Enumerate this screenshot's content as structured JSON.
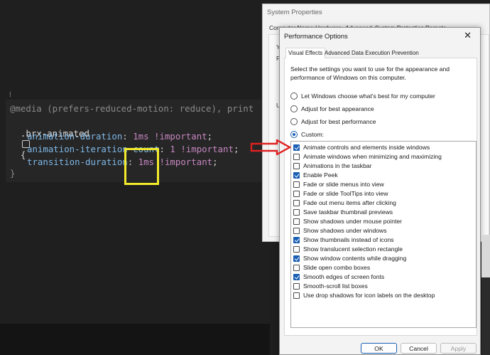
{
  "editor": {
    "gutter_mark": "⁞",
    "lines": {
      "media": "@media (prefers-reduced-motion: reduce), print",
      "selector": ".brx-animated",
      "brace_open": "{",
      "l1_prop": "animation-duration",
      "l1_val": "1ms !important",
      "l2_prop": "animation-iteration-count",
      "l2_val": "1 !important",
      "l3_prop": "transition-duration",
      "l3_val": "1ms !important",
      "brace_close": "}"
    },
    "highlight_color": "#f3ea2a"
  },
  "system_properties": {
    "title": "System Properties",
    "tabs": [
      "Computer Name",
      "Hardware",
      "Advanced",
      "System Protection",
      "Remote"
    ],
    "fragments": [
      "Y",
      "P",
      "U"
    ]
  },
  "performance_options": {
    "title": "Performance Options",
    "close_glyph": "✕",
    "tabs": [
      "Visual Effects",
      "Advanced",
      "Data Execution Prevention"
    ],
    "active_tab": "Visual Effects",
    "description": "Select the settings you want to use for the appearance and performance of Windows on this computer.",
    "radios": [
      {
        "label": "Let Windows choose what's best for my computer",
        "selected": false
      },
      {
        "label": "Adjust for best appearance",
        "selected": false
      },
      {
        "label": "Adjust for best performance",
        "selected": false
      },
      {
        "label": "Custom:",
        "selected": true
      }
    ],
    "options": [
      {
        "label": "Animate controls and elements inside windows",
        "checked": true
      },
      {
        "label": "Animate windows when minimizing and maximizing",
        "checked": false
      },
      {
        "label": "Animations in the taskbar",
        "checked": false
      },
      {
        "label": "Enable Peek",
        "checked": true
      },
      {
        "label": "Fade or slide menus into view",
        "checked": false
      },
      {
        "label": "Fade or slide ToolTips into view",
        "checked": false
      },
      {
        "label": "Fade out menu items after clicking",
        "checked": false
      },
      {
        "label": "Save taskbar thumbnail previews",
        "checked": false
      },
      {
        "label": "Show shadows under mouse pointer",
        "checked": false
      },
      {
        "label": "Show shadows under windows",
        "checked": false
      },
      {
        "label": "Show thumbnails instead of icons",
        "checked": true
      },
      {
        "label": "Show translucent selection rectangle",
        "checked": false
      },
      {
        "label": "Show window contents while dragging",
        "checked": true
      },
      {
        "label": "Slide open combo boxes",
        "checked": false
      },
      {
        "label": "Smooth edges of screen fonts",
        "checked": true
      },
      {
        "label": "Smooth-scroll list boxes",
        "checked": false
      },
      {
        "label": "Use drop shadows for icon labels on the desktop",
        "checked": false
      }
    ],
    "buttons": {
      "ok": "OK",
      "cancel": "Cancel",
      "apply": "Apply"
    },
    "accent_color": "#1a5fb4"
  },
  "annotation": {
    "arrow_color": "#e02020"
  }
}
